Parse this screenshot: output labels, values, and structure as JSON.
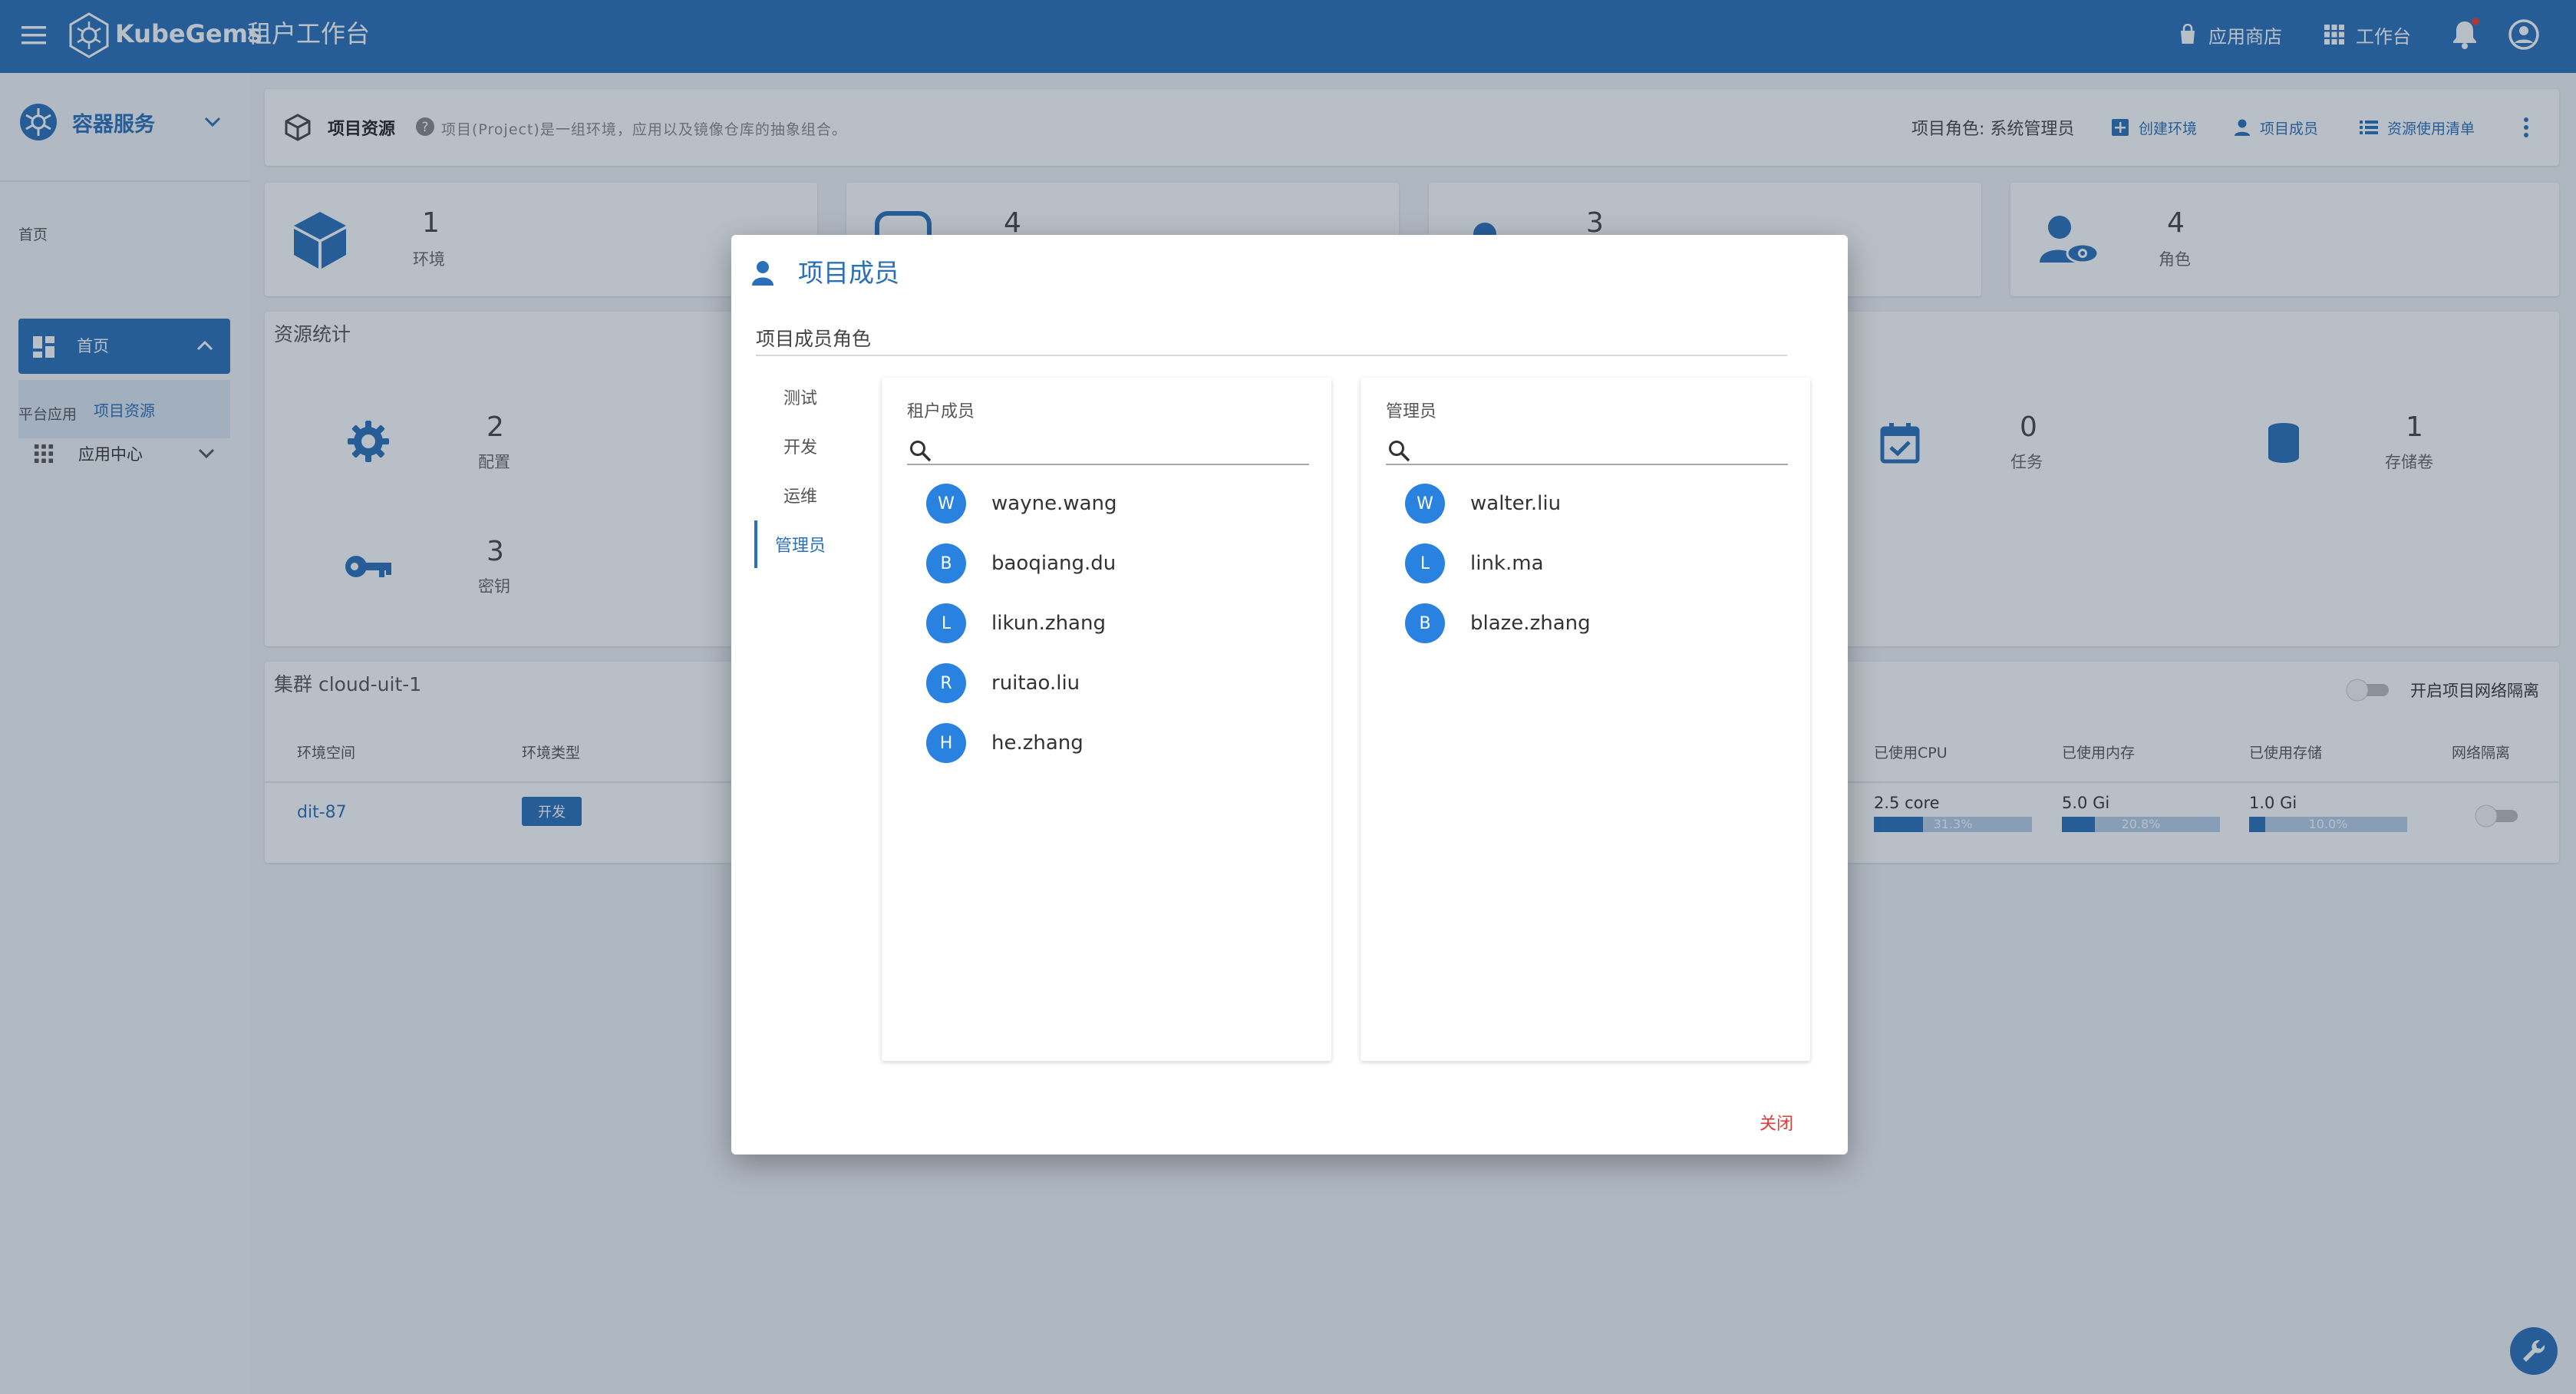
{
  "topbar": {
    "app_name": "KubeGems",
    "app_subtitle": "租户工作台",
    "store_label": "应用商店",
    "workbench_label": "工作台"
  },
  "sidebar": {
    "service_label": "容器服务",
    "group_home": "首页",
    "home_item": "首页",
    "sub_item": "项目资源",
    "group_platform": "平台应用",
    "app_center": "应用中心"
  },
  "header": {
    "title": "项目资源",
    "description": "项目(Project)是一组环境，应用以及镜像仓库的抽象组合。",
    "role_text": "项目角色: 系统管理员",
    "create_env": "创建环境",
    "members": "项目成员",
    "resource_list": "资源使用清单"
  },
  "stats": [
    {
      "value": "1",
      "label": "环境"
    },
    {
      "value": "4",
      "label": ""
    },
    {
      "value": "3",
      "label": ""
    },
    {
      "value": "4",
      "label": "角色"
    }
  ],
  "resources": {
    "title": "资源统计",
    "items": [
      {
        "value": "2",
        "label": "配置"
      },
      {
        "value": "3",
        "label": "密钥"
      },
      {
        "value": "0",
        "label": "任务"
      },
      {
        "value": "1",
        "label": "存储卷"
      }
    ]
  },
  "cluster": {
    "title": "集群 cloud-uit-1",
    "isolation_toggle_label": "开启项目网络隔离",
    "columns": [
      "环境空间",
      "环境类型",
      "已使用CPU",
      "已使用内存",
      "已使用存储",
      "网络隔离"
    ],
    "row": {
      "name": "dit-87",
      "type": "开发",
      "cpu": "2.5 core",
      "cpu_pct_label": "31.3%",
      "cpu_pct": 31.3,
      "mem": "5.0 Gi",
      "mem_pct_label": "20.8%",
      "mem_pct": 20.8,
      "storage": "1.0 Gi",
      "storage_pct_label": "10.0%",
      "storage_pct": 10.0
    }
  },
  "dialog": {
    "title": "项目成员",
    "section_label": "项目成员角色",
    "roles": [
      "测试",
      "开发",
      "运维",
      "管理员"
    ],
    "active_role": "管理员",
    "left_panel_title": "租户成员",
    "right_panel_title": "管理员",
    "tenant_members": [
      {
        "initial": "W",
        "name": "wayne.wang"
      },
      {
        "initial": "B",
        "name": "baoqiang.du"
      },
      {
        "initial": "L",
        "name": "likun.zhang"
      },
      {
        "initial": "R",
        "name": "ruitao.liu"
      },
      {
        "initial": "H",
        "name": "he.zhang"
      }
    ],
    "admin_members": [
      {
        "initial": "W",
        "name": "walter.liu"
      },
      {
        "initial": "L",
        "name": "link.ma"
      },
      {
        "initial": "B",
        "name": "blaze.zhang"
      }
    ],
    "close_label": "关闭"
  },
  "colors": {
    "primary": "#2a6fb8",
    "avatar": "#2a82e0",
    "close": "#e53935"
  }
}
